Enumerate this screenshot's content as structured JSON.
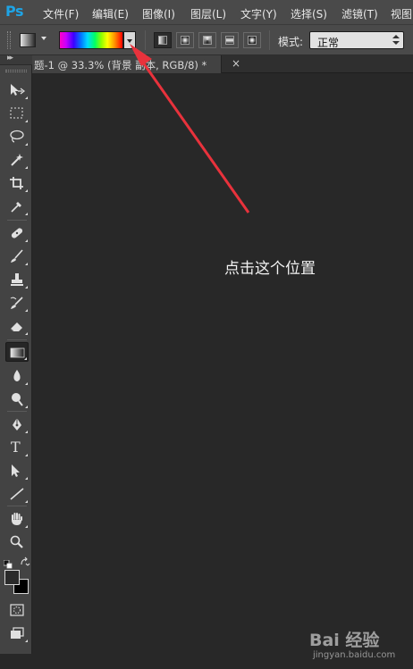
{
  "app": {
    "logo": "Ps"
  },
  "menu": [
    {
      "label": "文件(F)"
    },
    {
      "label": "编辑(E)"
    },
    {
      "label": "图像(I)"
    },
    {
      "label": "图层(L)"
    },
    {
      "label": "文字(Y)"
    },
    {
      "label": "选择(S)"
    },
    {
      "label": "滤镜(T)"
    },
    {
      "label": "视图"
    }
  ],
  "options_bar": {
    "tool_preset_icon": "gradient-preset-icon",
    "gradient_picker": "spectrum-gradient",
    "gradient_types": [
      {
        "name": "linear-gradient-icon",
        "active": true
      },
      {
        "name": "radial-gradient-icon",
        "active": false
      },
      {
        "name": "angle-gradient-icon",
        "active": false
      },
      {
        "name": "reflected-gradient-icon",
        "active": false
      },
      {
        "name": "diamond-gradient-icon",
        "active": false
      }
    ],
    "mode_label": "模式:",
    "mode_value": "正常"
  },
  "document_tab": {
    "title": "题-1 @ 33.3% (背景 副本, RGB/8) *",
    "close": "×"
  },
  "tools": [
    {
      "name": "move-tool-icon"
    },
    {
      "name": "marquee-tool-icon"
    },
    {
      "name": "lasso-tool-icon"
    },
    {
      "name": "magic-wand-tool-icon"
    },
    {
      "name": "crop-tool-icon"
    },
    {
      "name": "eyedropper-tool-icon"
    },
    {
      "name": "healing-brush-tool-icon"
    },
    {
      "name": "brush-tool-icon"
    },
    {
      "name": "clone-stamp-tool-icon"
    },
    {
      "name": "history-brush-tool-icon"
    },
    {
      "name": "eraser-tool-icon"
    },
    {
      "name": "gradient-tool-icon",
      "active": true
    },
    {
      "name": "blur-tool-icon"
    },
    {
      "name": "dodge-tool-icon"
    },
    {
      "name": "pen-tool-icon"
    },
    {
      "name": "type-tool-icon",
      "glyph": "T"
    },
    {
      "name": "path-selection-tool-icon"
    },
    {
      "name": "line-tool-icon"
    },
    {
      "name": "hand-tool-icon"
    },
    {
      "name": "zoom-tool-icon"
    }
  ],
  "colors": {
    "foreground": "#2a2a2a",
    "background": "#000000",
    "arrow": "#e8323c",
    "accent_logo": "#1ea4e6"
  },
  "annotation": {
    "text": "点击这个位置"
  },
  "watermark": {
    "line1": "Bai 经验",
    "line2": "jingyan.baidu.com"
  }
}
